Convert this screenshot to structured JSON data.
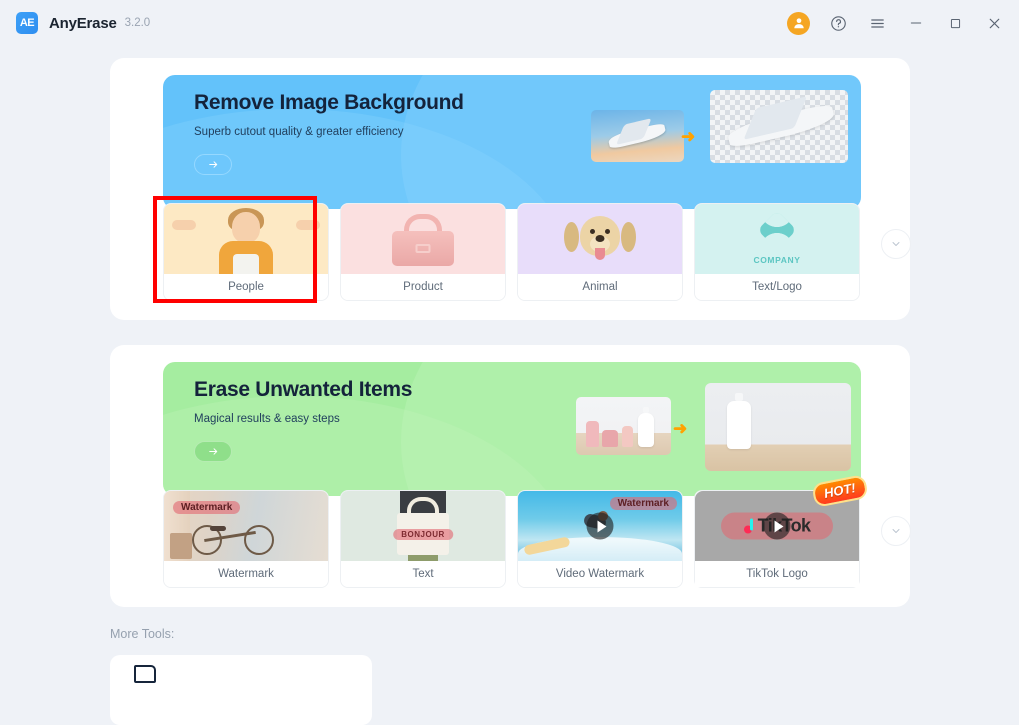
{
  "window": {
    "app_name": "AnyErase",
    "version": "3.2.0",
    "logo_text": "AE",
    "controls": {
      "account": "account-avatar",
      "help": "?",
      "menu": "menu",
      "minimize": "minimize",
      "maximize": "maximize",
      "close": "close"
    }
  },
  "sections": [
    {
      "id": "remove-image-background",
      "banner": {
        "title": "Remove Image Background",
        "subtitle": "Superb cutout quality & greater efficiency",
        "cta": "go-arrow",
        "theme": "#63c2fa"
      },
      "expand": "chevron-down",
      "cards": [
        {
          "label": "People",
          "selected": true
        },
        {
          "label": "Product",
          "selected": false
        },
        {
          "label": "Animal",
          "selected": false
        },
        {
          "label": "Text/Logo",
          "selected": false,
          "thumb_text": "COMPANY"
        }
      ]
    },
    {
      "id": "erase-unwanted-items",
      "banner": {
        "title": "Erase Unwanted Items",
        "subtitle": "Magical results & easy steps",
        "cta": "go-arrow",
        "theme": "#a5eda0"
      },
      "expand": "chevron-down",
      "cards": [
        {
          "label": "Watermark",
          "selected": false,
          "thumb_text": "Watermark"
        },
        {
          "label": "Text",
          "selected": false,
          "thumb_text": "BONJOUR"
        },
        {
          "label": "Video Watermark",
          "selected": false,
          "thumb_text": "Watermark"
        },
        {
          "label": "TikTok Logo",
          "selected": false,
          "thumb_text": "TikTok",
          "badge": "HOT!"
        }
      ]
    }
  ],
  "more_tools": {
    "label": "More Tools:"
  },
  "colors": {
    "page_bg": "#eff2f7",
    "panel_bg": "#ffffff",
    "accent_blue": "#63c2fa",
    "accent_green": "#a5eda0",
    "avatar_orange": "#f5a623",
    "selection_red": "#ff0000",
    "label_text": "#5f6b79"
  }
}
